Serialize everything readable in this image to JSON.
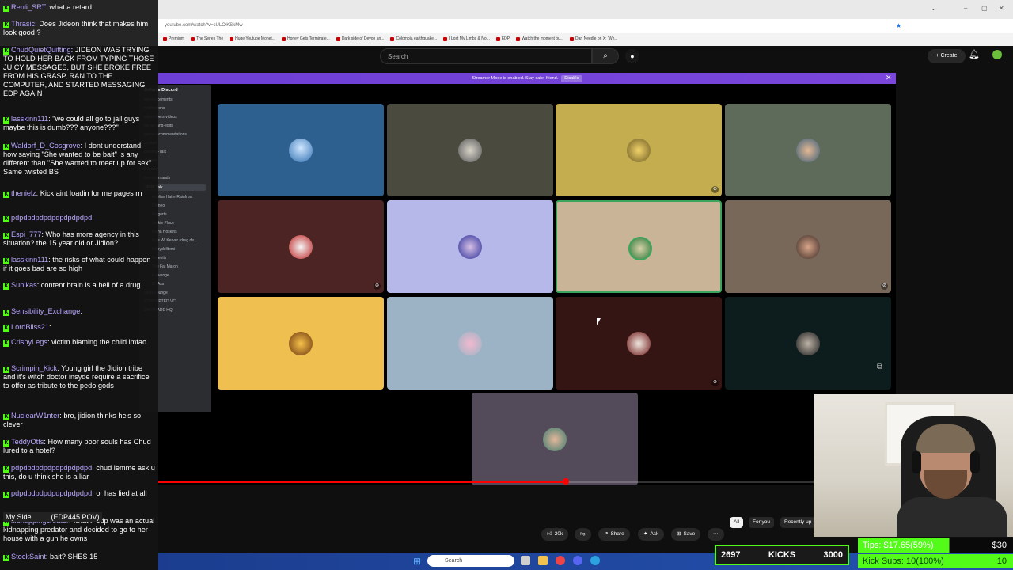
{
  "browser": {
    "address": "youtube.com/watch?v=cULOiKSkMw",
    "bookmarks": [
      "Premium",
      "The Series The",
      "Huge Youtube Monet...",
      "Honey Gets Terminate...",
      "Dark side of Devon an...",
      "Colombia earthquake...",
      "I Lost My Limbs & No...",
      "EDP",
      "Watch the moment bu...",
      "Dan Needle on X: 'Wh..."
    ]
  },
  "youtube": {
    "search_placeholder": "Search",
    "create_label": "+ Create",
    "progress_fraction": 0.622,
    "chips": [
      "All",
      "For you",
      "Recently up"
    ],
    "actions": {
      "likes": "20k",
      "share": "Share",
      "ask": "Ask",
      "save": "Save",
      "more": "⋯"
    }
  },
  "discord": {
    "banner": "Streamer Mode is enabled. Stay safe, friend.",
    "banner_action": "Disable",
    "server_name": "Jidion's Discord",
    "channels": [
      "announcements",
      "notifications",
      "subscribers-videos",
      "fan-art-and-edits",
      "game-recommendations",
      "to-react",
      "Bowling-Talk",
      "memes",
      "1-tyrone",
      "bot-commands",
      "RAW Talk"
    ],
    "voice_users": [
      "Acolian Hater Rainfrost",
      "Cemeo",
      "Emgerts",
      "Jackie Place",
      "Kayla Hoskins",
      "Kyle W. Kerver (drug de...",
      "lettoydelltemi",
      "Serenity",
      "The Fat Maron",
      "il revenge",
      "B*-Ass"
    ],
    "footer": [
      "Links Lounge",
      "CORRUPTED VC",
      "DAYTRADE HQ"
    ],
    "tile_colors": [
      "#2d5f8f",
      "#4a4a3e",
      "#c4ad4e",
      "#5e6b5a",
      "#4c2424",
      "#b5b8e8",
      "#c9b497",
      "#78685a",
      "#efc04f",
      "#9bb3c4",
      "#351414",
      "#0d1d1d",
      "#544b5a"
    ]
  },
  "chat": [
    {
      "user": "Renli_SRT",
      "text": "what a retard"
    },
    {
      "user": "Thrasic",
      "text": "Does Jideon think that makes him look good ?"
    },
    {
      "user": "ChudQuietQuitting",
      "text": "JIDEON WAS TRYING TO HOLD HER BACK FROM TYPING THOSE JUICY MESSAGES, BUT SHE BROKE FREE FROM HIS GRASP, RAN TO THE COMPUTER, AND STARTED MESSAGING EDP AGAIN"
    },
    {
      "user": "lasskinn111",
      "text": "\"we could all go to jail guys maybe this is dumb??? anyone???\""
    },
    {
      "user": "Waldorf_D_Cosgrove",
      "text": "I dont understand how saying \"She wanted to be bait\" is any different than \"She wanted to meet up for sex\". Same twisted BS"
    },
    {
      "user": "thenielz",
      "text": "Kick aint loadin for me pages rn"
    },
    {
      "user": "pdpdpdpdpdpdpdpdpdpd",
      "text": ""
    },
    {
      "user": "Espi_777",
      "text": "Who has more agency in this situation? the 15 year old or Jidion?"
    },
    {
      "user": "lasskinn111",
      "text": "the risks of what could happen if it goes bad are so high"
    },
    {
      "user": "Sunikas",
      "text": "content brain is a hell of a drug"
    },
    {
      "user": "Sensibility_Exchange",
      "text": ""
    },
    {
      "user": "LordBliss21",
      "text": ""
    },
    {
      "user": "CrispyLegs",
      "text": "victim blaming the child lmfao"
    },
    {
      "user": "Scrimpin_Kick",
      "text": "Young girl the Jidion tribe and it's witch doctor insyde require a sacrifice to offer as tribute to the pedo gods"
    },
    {
      "user": "NuclearW1nter",
      "text": "bro, jidion thinks he's so clever"
    },
    {
      "user": "TeddyOtts",
      "text": "How many poor souls has Chud lured to a hotel?"
    },
    {
      "user": "pdpdpdpdpdpdpdpdpdpd",
      "text": "chud lemme ask u this, do u think she is a liar"
    },
    {
      "user": "pdpdpdpdpdpdpdpdpdpd",
      "text": "or has lied at all"
    },
    {
      "user": "kidnappingcreator",
      "text": "what if edp was an actual kidnapping predator and decided to go to her house with a gun he owns"
    },
    {
      "user": "StockSaint",
      "text": "bait? SHES 15"
    }
  ],
  "overlay": {
    "my_side": "My Side",
    "my_side_tag": "(EDP445 POV)",
    "kicks_count": "2697",
    "kicks_label": "KICKS",
    "kicks_goal": "3000",
    "tips_label": "Tips:",
    "tips_value": "$17.65(59%)",
    "tips_goal": "$30",
    "subs_label": "Kick Subs:",
    "subs_value": "10(100%)",
    "subs_goal": "10"
  },
  "taskbar": {
    "search": "Search"
  }
}
